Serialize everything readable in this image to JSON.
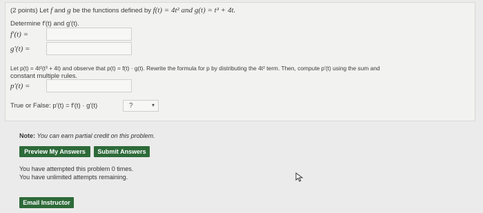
{
  "problem": {
    "intro_points": "(2 points) Let",
    "intro_f": "f",
    "intro_and": "and",
    "intro_g": "g",
    "intro_rest": "be the functions defined by",
    "f_def": "f(t) = 4t² and g(t) = t³ + 4t.",
    "determine_text": "Determine f′(t) and g′(t).",
    "fprime_label": "f′(t) =",
    "fprime_value": "",
    "gprime_label": "g′(t) =",
    "gprime_value": "",
    "part2_line1_a": "Let p(t) = 4t²(t³ + 4t) and observe that p(t) = f(t) · g(t). Rewrite the formula for p by distributing the 4t² term. Then, compute p′(t) using the sum and",
    "part2_line2": "constant multiple rules.",
    "pprime_label": "p′(t) =",
    "pprime_value": "",
    "tf_text": "True or False: p′(t) = f′(t) · g′(t)",
    "tf_selected": "?"
  },
  "note": {
    "label": "Note:",
    "text": "You can earn partial credit on this problem."
  },
  "buttons": {
    "preview": "Preview My Answers",
    "submit": "Submit Answers",
    "email": "Email Instructor"
  },
  "status": {
    "attempts": "You have attempted this problem 0 times.",
    "remaining": "You have unlimited attempts remaining."
  },
  "colors": {
    "button_bg": "#2d6a39",
    "panel_bg": "#f2f2f1",
    "page_bg": "#ecebeb"
  },
  "icons": {
    "cursor": "mouse-pointer-icon",
    "dropdown": "chevron-down-icon"
  }
}
